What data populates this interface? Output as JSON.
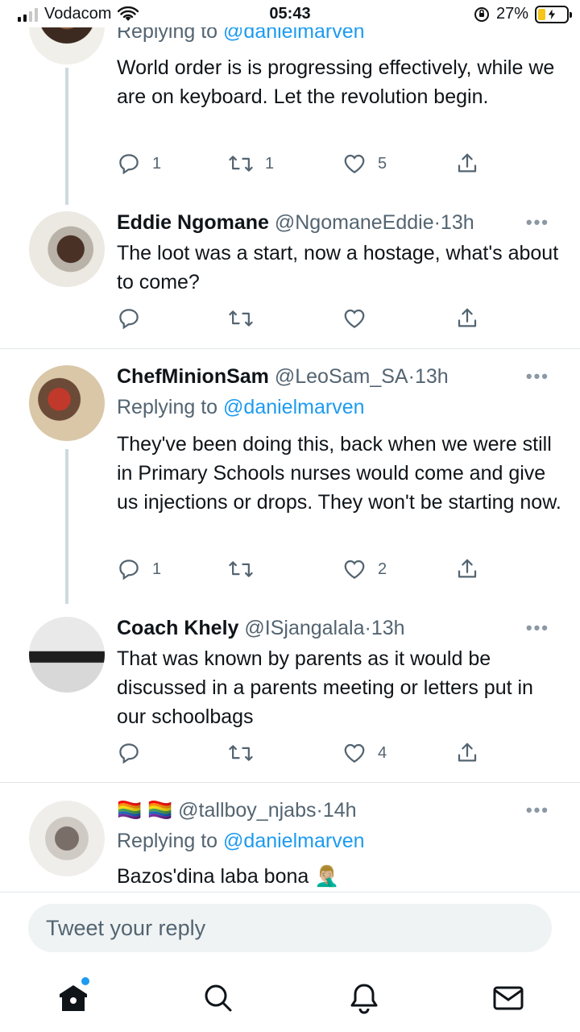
{
  "status_bar": {
    "carrier": "Vodacom",
    "time": "05:43",
    "battery": "27%",
    "battery_level": 0.27
  },
  "tweets": [
    {
      "name": "",
      "handle": "",
      "ago": "",
      "replying_prefix": "Replying to",
      "mention": "@danielmarven",
      "text": "World order is is progressing effectively, while we are on keyboard. Let the revolution begin.",
      "replies": "1",
      "retweets": "1",
      "likes": "5"
    },
    {
      "name": "Eddie Ngomane",
      "handle": "@NgomaneEddie",
      "ago": "13h",
      "text": "The loot was a start, now a hostage, what's about to come?",
      "replies": "",
      "retweets": "",
      "likes": ""
    },
    {
      "name": "ChefMinionSam",
      "handle": "@LeoSam_SA",
      "ago": "13h",
      "replying_prefix": "Replying to",
      "mention": "@danielmarven",
      "text": "They've been doing this, back when we were still in Primary Schools nurses would come and give us injections or drops. They won't be starting now.",
      "replies": "1",
      "retweets": "",
      "likes": "2"
    },
    {
      "name": "Coach Khely",
      "handle": "@ISjangalala",
      "ago": "13h",
      "text": "That was known by parents as it would be discussed in a parents meeting or letters put in our schoolbags",
      "replies": "",
      "retweets": "",
      "likes": "4"
    },
    {
      "name": "🏳️‍🌈 🏳️‍🌈",
      "handle": "@tallboy_njabs",
      "ago": "14h",
      "replying_prefix": "Replying to",
      "mention": "@danielmarven",
      "text": "Bazos'dina laba bona 🤦🏼‍♂️",
      "replies": "",
      "retweets": "",
      "likes": ""
    }
  ],
  "tweet_separator": "·",
  "more_label": "•••",
  "reply_bar": {
    "placeholder": "Tweet your reply"
  },
  "nav": [
    "home-icon",
    "search-icon",
    "notifications-icon",
    "messages-icon"
  ],
  "colors": {
    "accent": "#1d9bf0",
    "muted": "#536471",
    "text": "#0f1419"
  }
}
